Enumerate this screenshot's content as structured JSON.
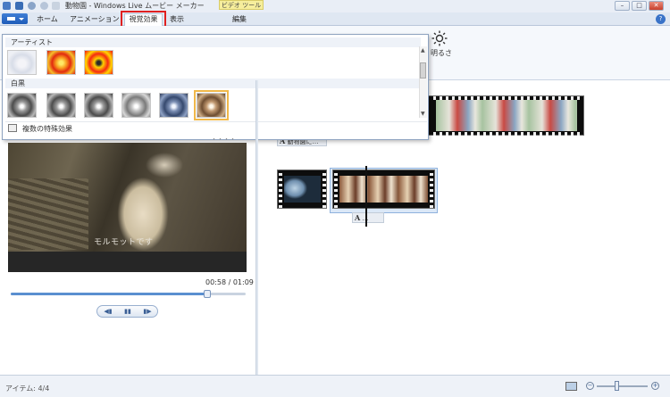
{
  "window": {
    "title": "動物園 - Windows Live ムービー メーカー",
    "context_tab": "ビデオ ツール",
    "controls": [
      "–",
      "□",
      "✕"
    ],
    "help": "?"
  },
  "tabs": {
    "home": "ホーム",
    "animation": "アニメーション",
    "visual_effects": "視覚効果",
    "view": "表示",
    "edit": "編集"
  },
  "ribbon": {
    "brightness_label": "明るさ"
  },
  "effects_gallery": {
    "group_artist": "アーティスト",
    "group_bw": "白黒",
    "multiple_effects": "複数の特殊効果",
    "grip": "・・・・"
  },
  "preview": {
    "caption": "モルモットです",
    "timecode": "00:58 / 01:09",
    "seek_progress": 0.84,
    "prev_glyph": "◀▮",
    "pause_glyph": "▮▮",
    "next_glyph": "▮▶"
  },
  "storyboard": {
    "caption_1": "動物園に…",
    "caption_2": "…",
    "caption_marker": "A"
  },
  "status": {
    "items": "アイテム: 4/4"
  },
  "zoom": {
    "out": "−",
    "in": "+",
    "level": 0.36
  },
  "colors": {
    "highlight": "#e02020",
    "accent": "#1d5bb8",
    "context_tab": "#f6ee9c",
    "selected_effect": "#f0b84a"
  }
}
